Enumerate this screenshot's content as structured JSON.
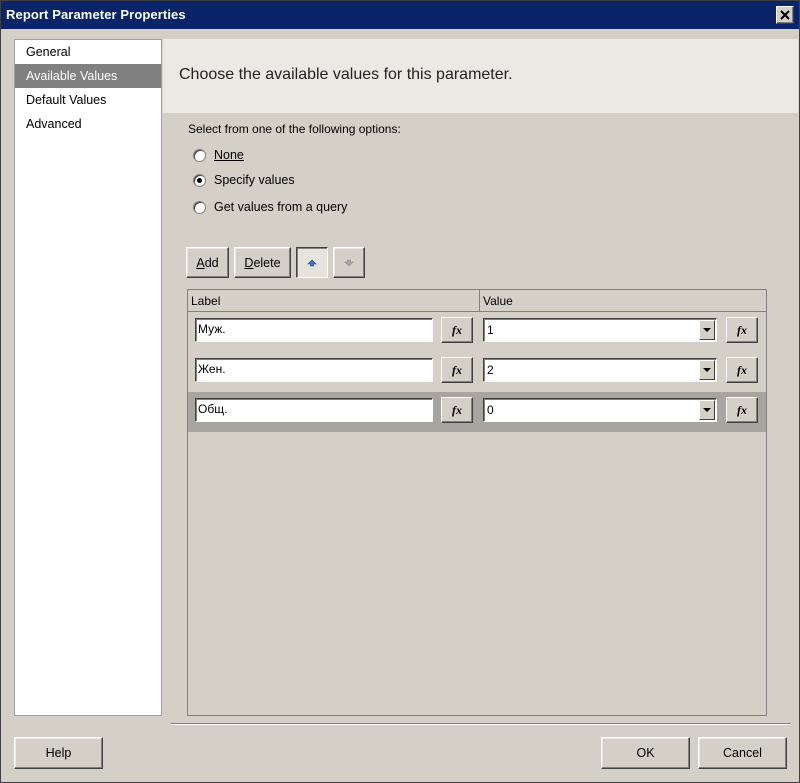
{
  "window": {
    "title": "Report Parameter Properties"
  },
  "nav": {
    "items": [
      {
        "label": "General"
      },
      {
        "label": "Available Values"
      },
      {
        "label": "Default Values"
      },
      {
        "label": "Advanced"
      }
    ],
    "selected": "Available Values"
  },
  "header": {
    "heading": "Choose the available values for this parameter."
  },
  "options": {
    "title": "Select from one of the following options:",
    "none": {
      "label": "None",
      "checked": false
    },
    "specify": {
      "label": "Specify values",
      "checked": true
    },
    "query": {
      "label": "Get values from a query",
      "checked": false
    }
  },
  "toolbar": {
    "add": "Add",
    "delete": "Delete",
    "move_up_icon": "arrow-up-icon",
    "move_down_icon": "arrow-down-icon"
  },
  "grid": {
    "columns": [
      "Label",
      "Value"
    ],
    "fx_label": "fx",
    "rows": [
      {
        "label": "Муж.",
        "value": "1"
      },
      {
        "label": "Жен.",
        "value": "2"
      },
      {
        "label": "Общ.",
        "value": "0"
      }
    ],
    "selected_row": 2
  },
  "footer": {
    "help": "Help",
    "ok": "OK",
    "cancel": "Cancel"
  }
}
